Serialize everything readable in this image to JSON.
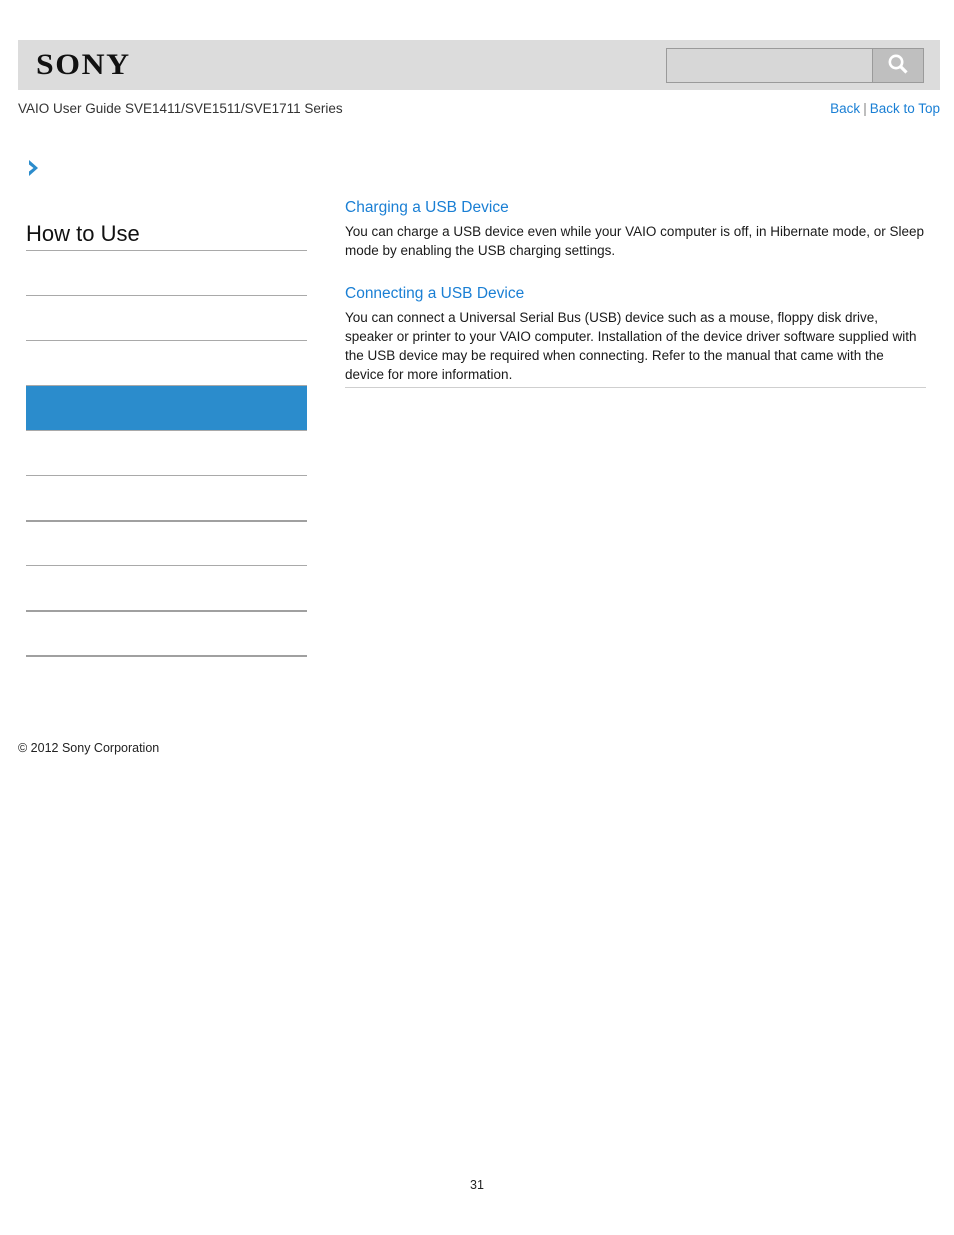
{
  "header": {
    "logo_text": "SONY",
    "logo_icon": "sony-wordmark",
    "search": {
      "value": "",
      "placeholder": "",
      "button_icon": "search-icon"
    }
  },
  "title_row": {
    "guide_title": "VAIO User Guide SVE1411/SVE1511/SVE1711 Series",
    "back_label": "Back",
    "separator": "|",
    "back_to_top_label": "Back to Top"
  },
  "sidebar": {
    "chevron_icon": "chevron-right-icon",
    "heading": "How to Use",
    "items": [
      {
        "label": "",
        "active": false,
        "thick": false
      },
      {
        "label": "",
        "active": false,
        "thick": false
      },
      {
        "label": "",
        "active": false,
        "thick": false
      },
      {
        "label": "",
        "active": true,
        "thick": false
      },
      {
        "label": "",
        "active": false,
        "thick": false
      },
      {
        "label": "",
        "active": false,
        "thick": false
      },
      {
        "label": "",
        "active": false,
        "thick": true
      },
      {
        "label": "",
        "active": false,
        "thick": false
      },
      {
        "label": "",
        "active": false,
        "thick": true
      }
    ],
    "copyright": "© 2012 Sony Corporation"
  },
  "content": {
    "topics": [
      {
        "title": "Charging a USB Device",
        "body": "You can charge a USB device even while your VAIO computer is off, in Hibernate mode, or Sleep mode by enabling the USB charging settings."
      },
      {
        "title": "Connecting a USB Device",
        "body": "You can connect a Universal Serial Bus (USB) device such as a mouse, floppy disk drive, speaker or printer to your VAIO computer. Installation of the device driver software supplied with the USB device may be required when connecting. Refer to the manual that came with the device for more information."
      }
    ]
  },
  "footer": {
    "page_number": "31"
  },
  "colors": {
    "accent_blue": "#2b8ccc",
    "link_blue": "#1a7fd4",
    "header_gray": "#dcdcdc",
    "divider_gray": "#a9a9a9"
  }
}
